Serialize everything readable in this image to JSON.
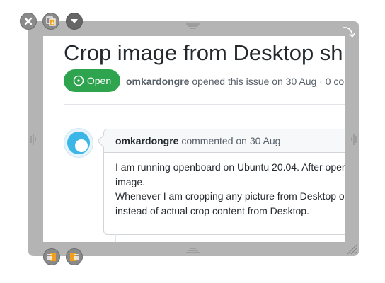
{
  "issue": {
    "title": "Crop image from Desktop sh",
    "status_label": "Open",
    "author": "omkardongre",
    "meta_text": "opened this issue on 30 Aug · 0 co"
  },
  "comment": {
    "author": "omkardongre",
    "meta_text": "commented on 30 Aug",
    "lines": [
      "I am running openboard on Ubuntu 20.04. After oper",
      "image.",
      "Whenever I am cropping any picture from Desktop or",
      "instead of actual crop content from Desktop."
    ]
  },
  "colors": {
    "frame": "#b4b4b4",
    "open_badge": "#2ea44f",
    "avatar": "#3bb6e6",
    "control_orange": "#f0a020"
  },
  "icons": {
    "close": "close-icon",
    "duplicate": "duplicate-icon",
    "menu": "chevron-down-icon",
    "rotate": "rotate-icon",
    "resize": "resize-icon",
    "layer_back": "layer-down-icon",
    "layer_front": "layer-up-icon"
  }
}
